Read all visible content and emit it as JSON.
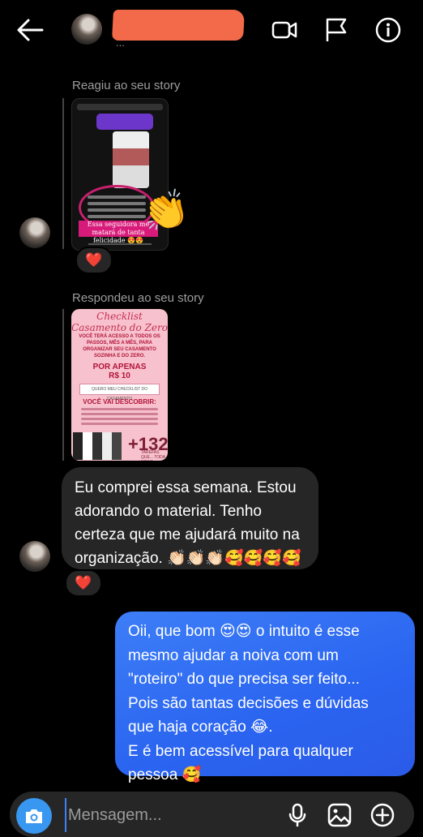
{
  "header": {
    "username": "",
    "subtitle": "...",
    "icons": [
      "arrow-left-icon",
      "video-camera-icon",
      "flag-icon",
      "info-icon"
    ]
  },
  "messages": [
    {
      "type": "story_reaction",
      "label": "Reagiu ao seu story",
      "story_text": "Essa seguidora me matará de tanta felicidade 😍😍",
      "reaction_emoji": "👏",
      "heart": "❤️"
    },
    {
      "type": "story_reply",
      "label": "Respondeu ao seu story",
      "story": {
        "title": "Checklist Casamento do Zero",
        "intro": "VOCÊ TERÁ ACESSO A TODOS OS PASSOS, MÊS A MÊS, PARA ORGANIZAR SEU CASAMENTO SOZINHA E DO ZERO.",
        "price_label": "POR APENAS",
        "price": "R$ 10",
        "button": "QUERO MEU CHECKLIST DO CASAMENTO",
        "discover": "VOCÊ VAI DESCOBRIR:",
        "count": "+132",
        "count_label": "TAREFAS QUE... TODA NOIVA"
      }
    },
    {
      "type": "received",
      "text": "Eu comprei essa semana. Estou\nadorando o material. Tenho\ncerteza que me ajudará muito na\norganização. 👏🏻👏🏻👏🏻🥰🥰🥰🥰",
      "heart": "❤️"
    },
    {
      "type": "sent",
      "text": "Oii, que bom 😍😍 o intuito é esse\nmesmo ajudar a noiva com um\n\"roteiro\" do que precisa ser feito...\nPois são tantas decisões e dúvidas\nque haja coração 😂.\nE é bem acessível para qualquer\npessoa 🥰"
    }
  ],
  "composer": {
    "placeholder": "Mensagem...",
    "icons": [
      "camera-icon",
      "microphone-icon",
      "gallery-icon",
      "plus-circle-icon"
    ]
  },
  "colors": {
    "background": "#000000",
    "received_bubble": "#262626",
    "sent_bubble": "#2a64f0",
    "camera_button": "#3897f0",
    "redaction": "#f26a4a"
  }
}
